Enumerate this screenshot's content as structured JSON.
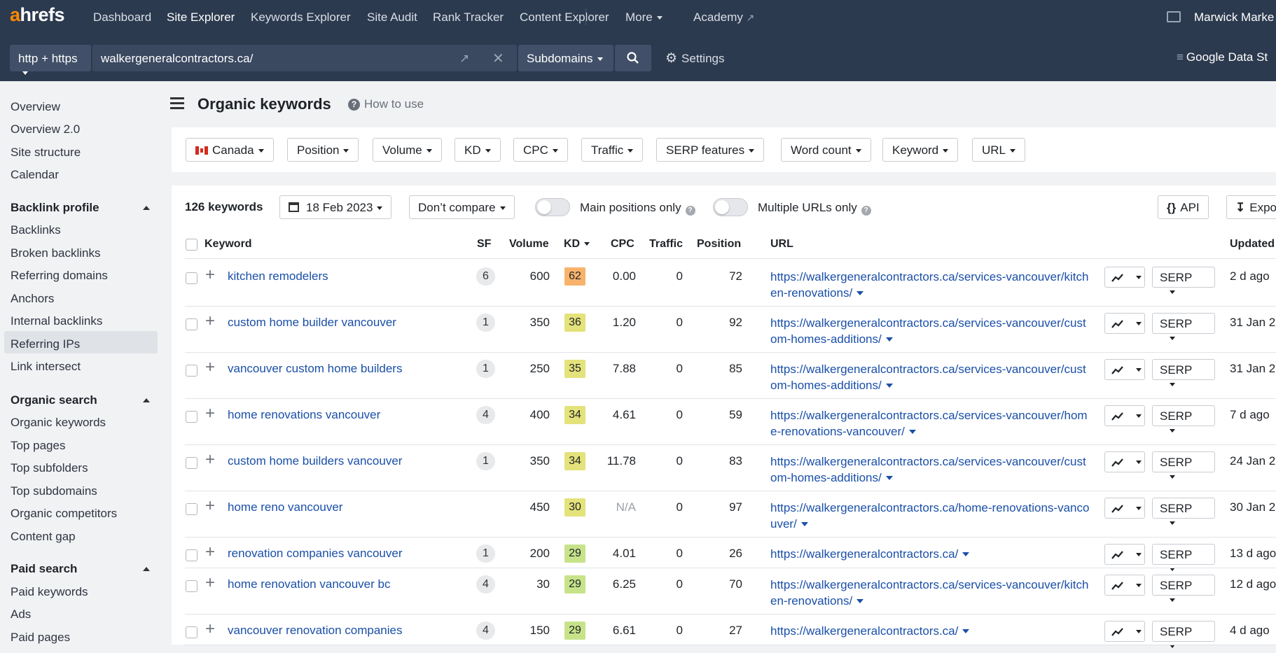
{
  "logo": {
    "a": "a",
    "rest": "hrefs"
  },
  "nav": {
    "dashboard": "Dashboard",
    "site_explorer": "Site Explorer",
    "keywords_explorer": "Keywords Explorer",
    "site_audit": "Site Audit",
    "rank_tracker": "Rank Tracker",
    "content_explorer": "Content Explorer",
    "more": "More",
    "academy": "Academy",
    "account": "Marwick Marke"
  },
  "search": {
    "protocol": "http + https",
    "url": "walkergeneralcontractors.ca/",
    "mode": "Subdomains",
    "settings": "Settings",
    "gds": "Google Data St"
  },
  "sidebar": {
    "top": [
      "Overview",
      "Overview 2.0",
      "Site structure",
      "Calendar"
    ],
    "backlink_head": "Backlink profile",
    "backlink": [
      "Backlinks",
      "Broken backlinks",
      "Referring domains",
      "Anchors",
      "Internal backlinks",
      "Referring IPs",
      "Link intersect"
    ],
    "organic_head": "Organic search",
    "organic": [
      "Organic keywords",
      "Top pages",
      "Top subfolders",
      "Top subdomains",
      "Organic competitors",
      "Content gap"
    ],
    "paid_head": "Paid search",
    "paid": [
      "Paid keywords",
      "Ads",
      "Paid pages"
    ]
  },
  "page": {
    "title": "Organic keywords",
    "howto": "How to use"
  },
  "filters": [
    "Canada",
    "Position",
    "Volume",
    "KD",
    "CPC",
    "Traffic",
    "SERP features",
    "Word count",
    "Keyword",
    "URL"
  ],
  "toolbar": {
    "count": "126 keywords",
    "date": "18 Feb 2023",
    "compare": "Don’t compare",
    "main_positions": "Main positions only",
    "multiple_urls": "Multiple URLs only",
    "api": "API",
    "export": "Expo"
  },
  "columns": {
    "keyword": "Keyword",
    "sf": "SF",
    "volume": "Volume",
    "kd": "KD",
    "cpc": "CPC",
    "traffic": "Traffic",
    "position": "Position",
    "url": "URL",
    "updated": "Updated"
  },
  "rows": [
    {
      "keyword": "kitchen remodelers",
      "sf": "6",
      "volume": "600",
      "kd": "62",
      "kd_color": "#f7b36b",
      "cpc": "0.00",
      "traffic": "0",
      "position": "72",
      "url": "https://walkergeneralcontractors.ca/services-vancouver/kitchen-renovations/",
      "updated": "2 d ago",
      "serp": "SERP"
    },
    {
      "keyword": "custom home builder vancouver",
      "sf": "1",
      "volume": "350",
      "kd": "36",
      "kd_color": "#e4e27a",
      "cpc": "1.20",
      "traffic": "0",
      "position": "92",
      "url": "https://walkergeneralcontractors.ca/services-vancouver/custom-homes-additions/",
      "updated": "31 Jan 2",
      "serp": "SERP"
    },
    {
      "keyword": "vancouver custom home builders",
      "sf": "1",
      "volume": "250",
      "kd": "35",
      "kd_color": "#e4e27a",
      "cpc": "7.88",
      "traffic": "0",
      "position": "85",
      "url": "https://walkergeneralcontractors.ca/services-vancouver/custom-homes-additions/",
      "updated": "31 Jan 2",
      "serp": "SERP"
    },
    {
      "keyword": "home renovations vancouver",
      "sf": "4",
      "volume": "400",
      "kd": "34",
      "kd_color": "#e4e27a",
      "cpc": "4.61",
      "traffic": "0",
      "position": "59",
      "url": "https://walkergeneralcontractors.ca/services-vancouver/home-renovations-vancouver/",
      "updated": "7 d ago",
      "serp": "SERP"
    },
    {
      "keyword": "custom home builders vancouver",
      "sf": "1",
      "volume": "350",
      "kd": "34",
      "kd_color": "#e4e27a",
      "cpc": "11.78",
      "traffic": "0",
      "position": "83",
      "url": "https://walkergeneralcontractors.ca/services-vancouver/custom-homes-additions/",
      "updated": "24 Jan 2",
      "serp": "SERP"
    },
    {
      "keyword": "home reno vancouver",
      "sf": "",
      "volume": "450",
      "kd": "30",
      "kd_color": "#e4e27a",
      "cpc": "N/A",
      "traffic": "0",
      "position": "97",
      "url": "https://walkergeneralcontractors.ca/home-renovations-vancouver/",
      "updated": "30 Jan 2",
      "serp": "SERP"
    },
    {
      "keyword": "renovation companies vancouver",
      "sf": "1",
      "volume": "200",
      "kd": "29",
      "kd_color": "#c7e38a",
      "cpc": "4.01",
      "traffic": "0",
      "position": "26",
      "url": "https://walkergeneralcontractors.ca/",
      "updated": "13 d ago",
      "serp": "SERP"
    },
    {
      "keyword": "home renovation vancouver bc",
      "sf": "4",
      "volume": "30",
      "kd": "29",
      "kd_color": "#c7e38a",
      "cpc": "6.25",
      "traffic": "0",
      "position": "70",
      "url": "https://walkergeneralcontractors.ca/services-vancouver/kitchen-renovations/",
      "updated": "12 d ago",
      "serp": "SERP"
    },
    {
      "keyword": "vancouver renovation companies",
      "sf": "4",
      "volume": "150",
      "kd": "29",
      "kd_color": "#c7e38a",
      "cpc": "6.61",
      "traffic": "0",
      "position": "27",
      "url": "https://walkergeneralcontractors.ca/",
      "updated": "4 d ago",
      "serp": "SERP"
    }
  ]
}
